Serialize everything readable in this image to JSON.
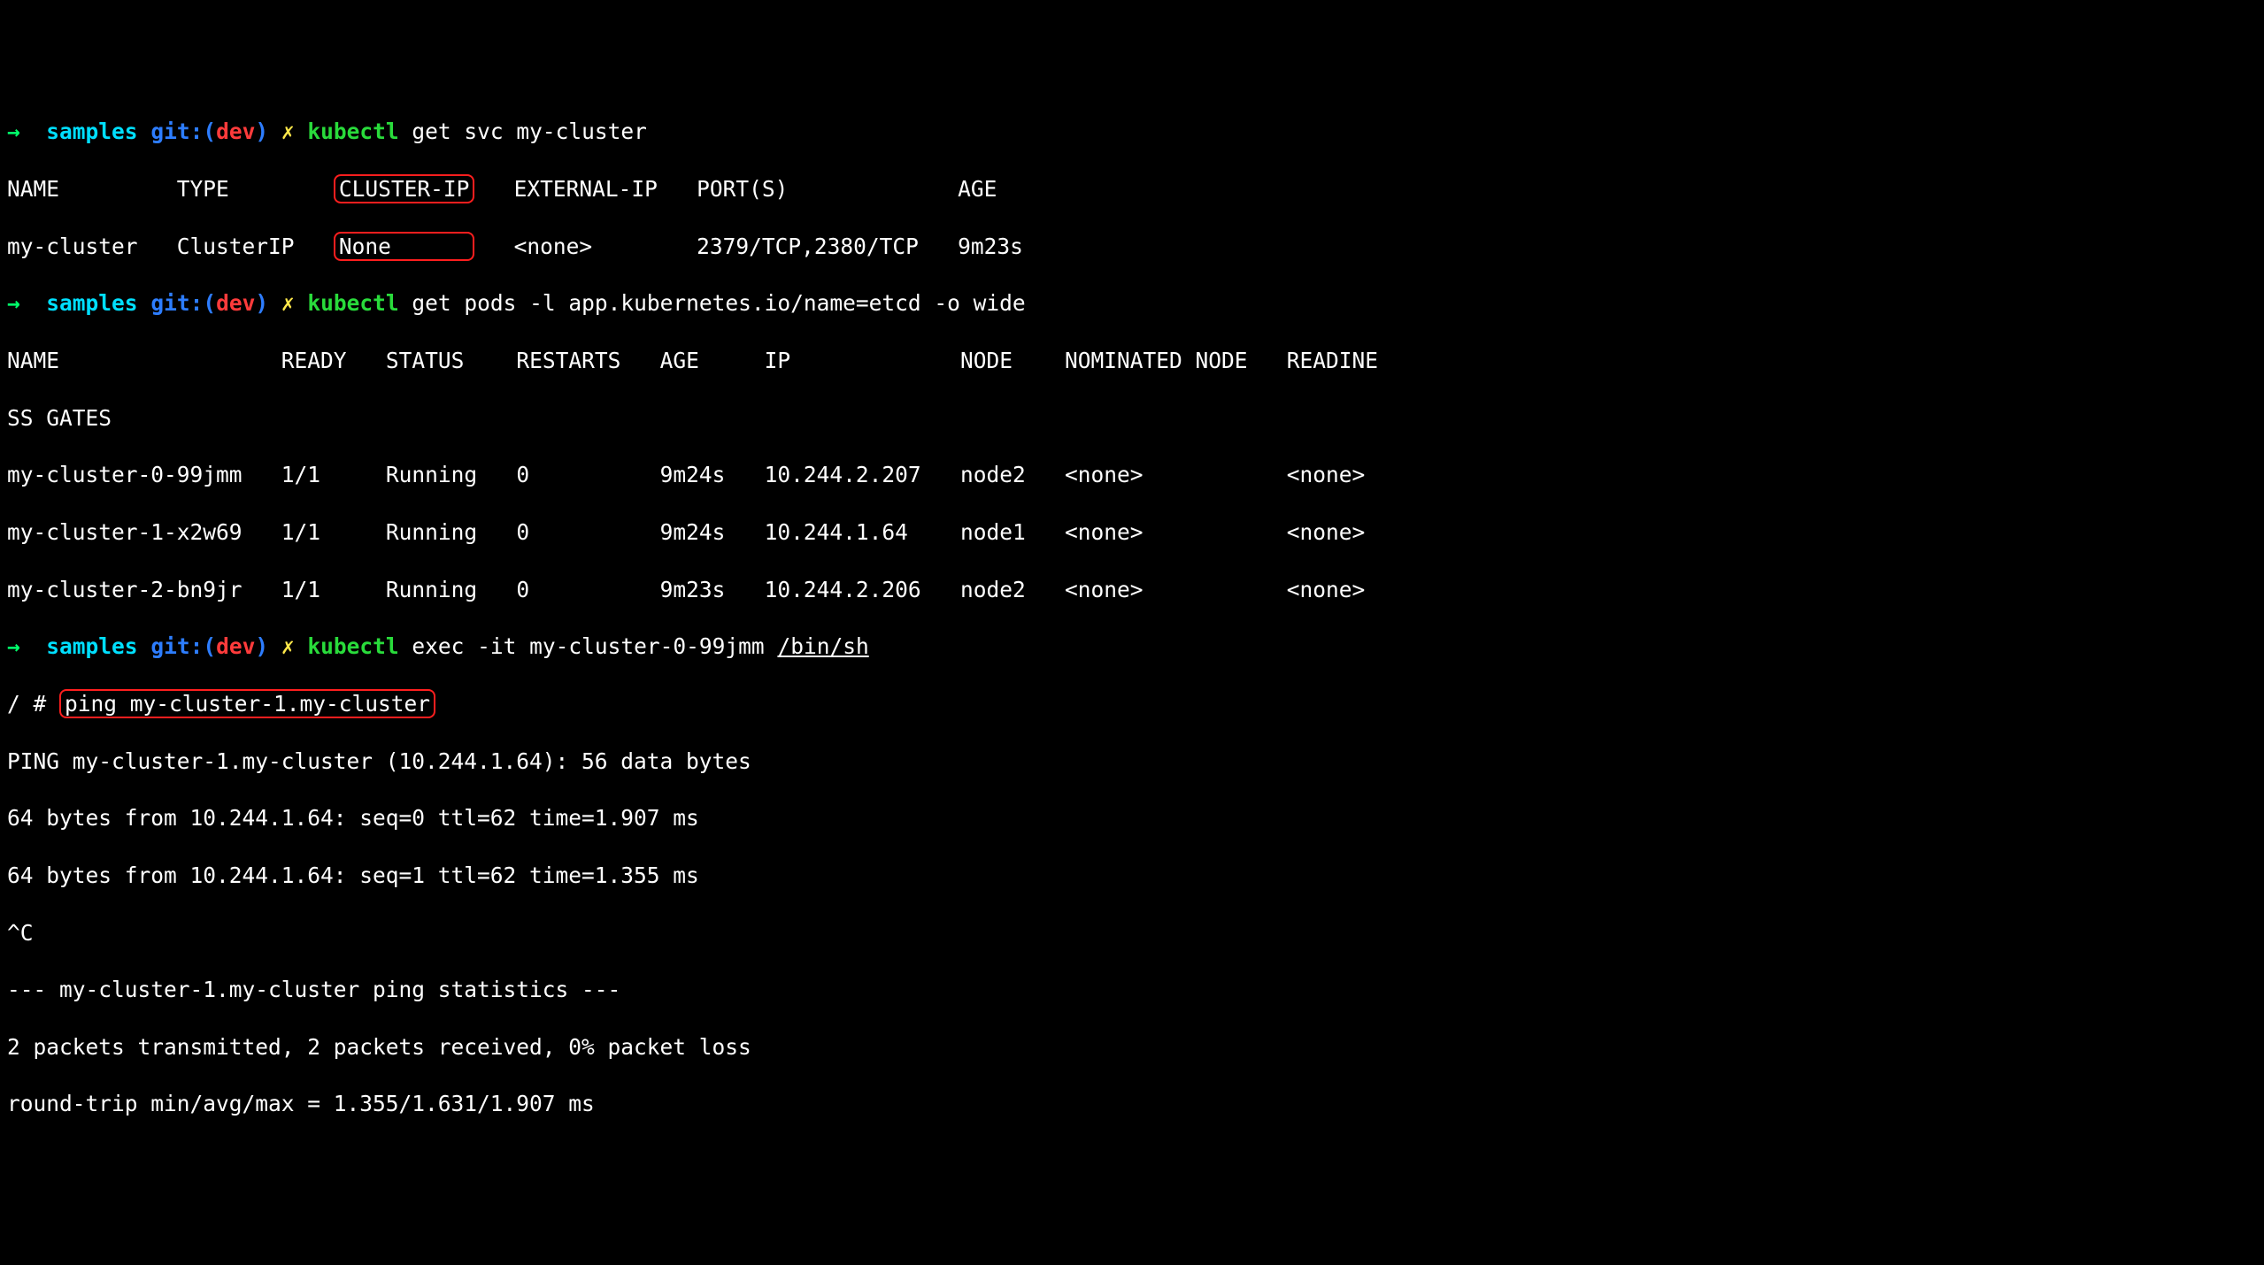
{
  "prompt": {
    "arrow": "→",
    "dir": "samples",
    "git_prefix": "git:(",
    "branch": "dev",
    "git_suffix": ")",
    "x": "✗",
    "cmd_word": "kubectl"
  },
  "cmd1": {
    "rest": " get svc my-cluster",
    "header": {
      "name": "NAME",
      "type": "TYPE",
      "clusterip": "CLUSTER-IP",
      "extip": "EXTERNAL-IP",
      "ports": "PORT(S)",
      "age": "AGE"
    },
    "row": {
      "name": "my-cluster",
      "type": "ClusterIP",
      "clusterip": "None",
      "extip": "<none>",
      "ports": "2379/TCP,2380/TCP",
      "age": "9m23s"
    }
  },
  "cmd2": {
    "rest": " get pods -l app.kubernetes.io/name=etcd -o wide",
    "header": {
      "name": "NAME",
      "ready": "READY",
      "status": "STATUS",
      "restarts": "RESTARTS",
      "age": "AGE",
      "ip": "IP",
      "node": "NODE",
      "nominated": "NOMINATED NODE",
      "readine": "READINE"
    },
    "ssgates": "SS GATES",
    "rows": [
      {
        "name": "my-cluster-0-99jmm",
        "ready": "1/1",
        "status": "Running",
        "restarts": "0",
        "age": "9m24s",
        "ip": "10.244.2.207",
        "node": "node2",
        "nominated": "<none>",
        "readine": "<none>"
      },
      {
        "name": "my-cluster-1-x2w69",
        "ready": "1/1",
        "status": "Running",
        "restarts": "0",
        "age": "9m24s",
        "ip": "10.244.1.64",
        "node": "node1",
        "nominated": "<none>",
        "readine": "<none>"
      },
      {
        "name": "my-cluster-2-bn9jr",
        "ready": "1/1",
        "status": "Running",
        "restarts": "0",
        "age": "9m23s",
        "ip": "10.244.2.206",
        "node": "node2",
        "nominated": "<none>",
        "readine": "<none>"
      }
    ]
  },
  "cmd3": {
    "rest_a": " exec -it my-cluster-0-99jmm ",
    "rest_b": "/bin/sh",
    "shell_prompt_a": "/ # ",
    "shell_cmd": "ping my-cluster-1.my-cluster",
    "out1": "PING my-cluster-1.my-cluster (10.244.1.64): 56 data bytes",
    "out2": "64 bytes from 10.244.1.64: seq=0 ttl=62 time=1.907 ms",
    "out3": "64 bytes from 10.244.1.64: seq=1 ttl=62 time=1.355 ms",
    "out4": "^C",
    "out5": "--- my-cluster-1.my-cluster ping statistics ---",
    "out6": "2 packets transmitted, 2 packets received, 0% packet loss",
    "out7": "round-trip min/avg/max = 1.355/1.631/1.907 ms"
  }
}
